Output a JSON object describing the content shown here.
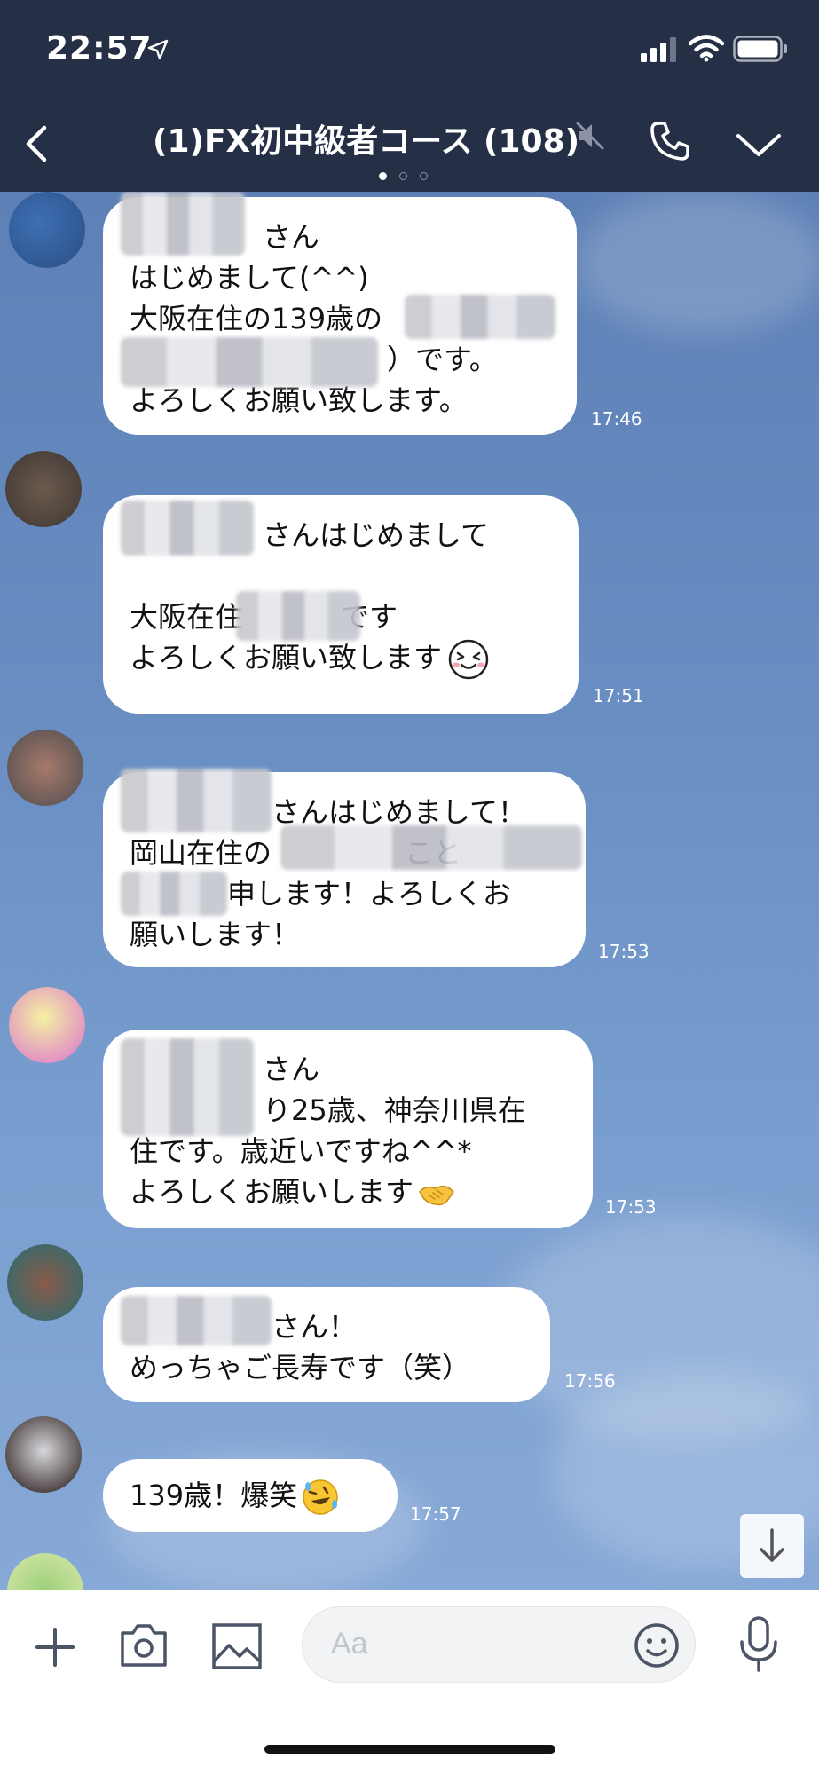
{
  "status_bar": {
    "time": "22:57"
  },
  "header": {
    "title": "(1)FX初中級者コース (108)",
    "page_indicator": {
      "total": 3,
      "active": 1
    }
  },
  "messages": [
    {
      "lines": [
        "さん",
        "はじめまして(^^)",
        "大阪在住の139歳の",
        "）です。",
        "よろしくお願い致します。"
      ],
      "time": "17:46"
    },
    {
      "lines": [
        "さんはじめまして",
        "",
        "大阪在住",
        "です",
        "よろしくお願い致します"
      ],
      "time": "17:51"
    },
    {
      "lines": [
        "さんはじめまして！",
        "岡山在住の",
        "こと",
        "申します！よろしくお",
        "願いします！"
      ],
      "time": "17:53"
    },
    {
      "lines": [
        "さん",
        "り25歳、神奈川県在",
        "住です。歳近いですね^^*",
        "よろしくお願いします"
      ],
      "time": "17:53"
    },
    {
      "lines": [
        "さん！",
        "めっちゃご長寿です（笑）"
      ],
      "time": "17:56"
    },
    {
      "lines": [
        "139歳！爆笑"
      ],
      "time": "17:57"
    }
  ],
  "input": {
    "placeholder": "Aa"
  },
  "colors": {
    "header_bg": "#253047",
    "chat_bg": "#6a8fc3",
    "bubble_bg": "#ffffff"
  }
}
